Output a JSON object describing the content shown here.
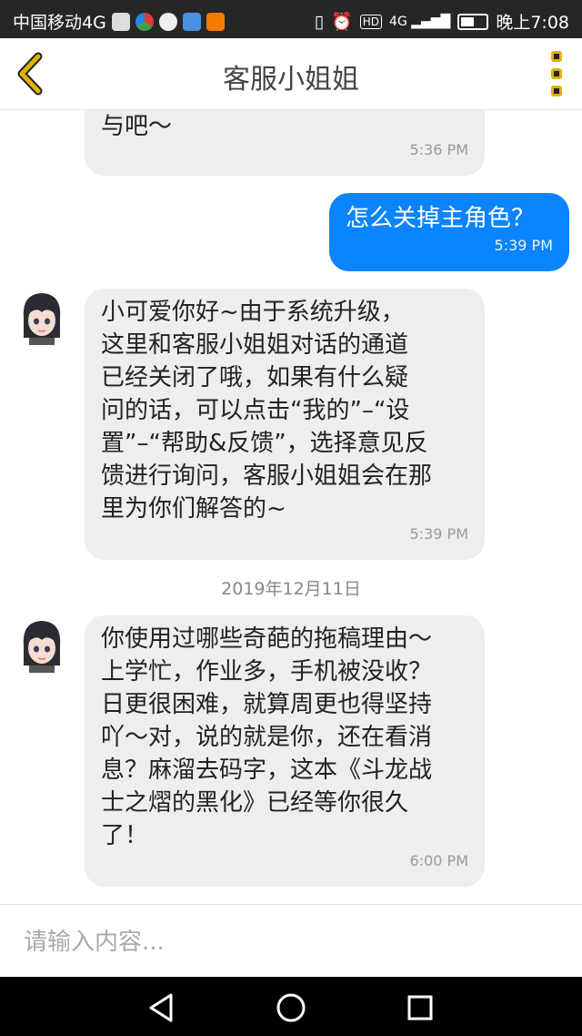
{
  "status_bar": {
    "carrier": "中国移动4G",
    "time": "晚上7:08",
    "network": "4G",
    "icons": [
      "notification-app-icon",
      "browser-app-icon",
      "search-app-icon",
      "cloud-app-icon",
      "video-app-icon",
      "vibrate-icon",
      "alarm-icon",
      "hd-icon",
      "signal-icon",
      "battery-icon"
    ]
  },
  "header": {
    "title": "客服小姐姐",
    "back_icon": "chevron-left-icon",
    "menu_icon": "more-vertical-icon",
    "accent_color": "#e0b100"
  },
  "messages": [
    {
      "side": "incoming",
      "text": "与吧～",
      "time": "5:36 PM"
    },
    {
      "side": "outgoing",
      "text": "怎么关掉主角色？",
      "time": "5:39 PM"
    },
    {
      "side": "incoming",
      "text": "小可爱你好~由于系统升级，\n这里和客服小姐姐对话的通道\n已经关闭了哦，如果有什么疑\n问的话，可以点击“我的”–“设\n置”–“帮助&反馈”，选择意见反\n馈进行询问，客服小姐姐会在那\n里为你们解答的~",
      "time": "5:39 PM"
    },
    {
      "side": "incoming",
      "text": "你使用过哪些奇葩的拖稿理由～\n上学忙，作业多，手机被没收？\n日更很困难，就算周更也得坚持\n吖～对，说的就是你，还在看消\n息？麻溜去码字，这本《斗龙战\n士之熠的黑化》已经等你很久\n了！",
      "time": "6:00 PM"
    }
  ],
  "date_separator": "2019年12月11日",
  "input": {
    "placeholder": "请输入内容..."
  },
  "nav_bar": {
    "buttons": [
      "back-triangle-icon",
      "home-circle-icon",
      "recents-square-icon"
    ]
  },
  "colors": {
    "outgoing_bubble": "#0a84ff",
    "incoming_bubble": "#eeeeee",
    "status_bar": "#262626"
  }
}
